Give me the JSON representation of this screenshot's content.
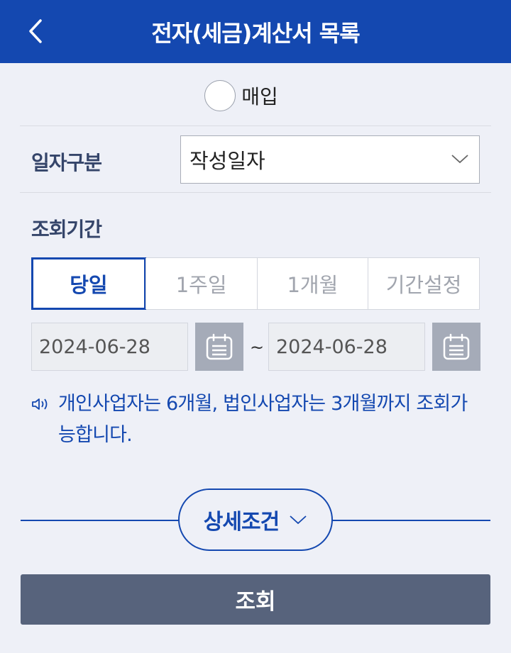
{
  "colors": {
    "header_bg": "#1448b0",
    "accent": "#1448b0",
    "label_text": "#35456a",
    "search_button_bg": "#57637c",
    "calendar_button_bg": "#a5abb8",
    "page_bg": "#eef0f7"
  },
  "header": {
    "title": "전자(세금)계산서 목록",
    "back_icon": "chevron-left-icon"
  },
  "radio": {
    "label": "매입",
    "checked": false
  },
  "date_type": {
    "label": "일자구분",
    "selected": "작성일자",
    "arrow_icon": "chevron-down-icon"
  },
  "period": {
    "label": "조회기간",
    "tabs": [
      {
        "label": "당일",
        "active": true
      },
      {
        "label": "1주일",
        "active": false
      },
      {
        "label": "1개월",
        "active": false
      },
      {
        "label": "기간설정",
        "active": false
      }
    ],
    "start_date": "2024-06-28",
    "end_date": "2024-06-28",
    "separator": "~",
    "calendar_icon": "calendar-icon"
  },
  "notice": {
    "icon": "speaker-icon",
    "text": "개인사업자는 6개월, 법인사업자는 3개월까지 조회가 능합니다."
  },
  "detail": {
    "label": "상세조건",
    "icon": "chevron-down-icon"
  },
  "search_button": {
    "label": "조회"
  }
}
